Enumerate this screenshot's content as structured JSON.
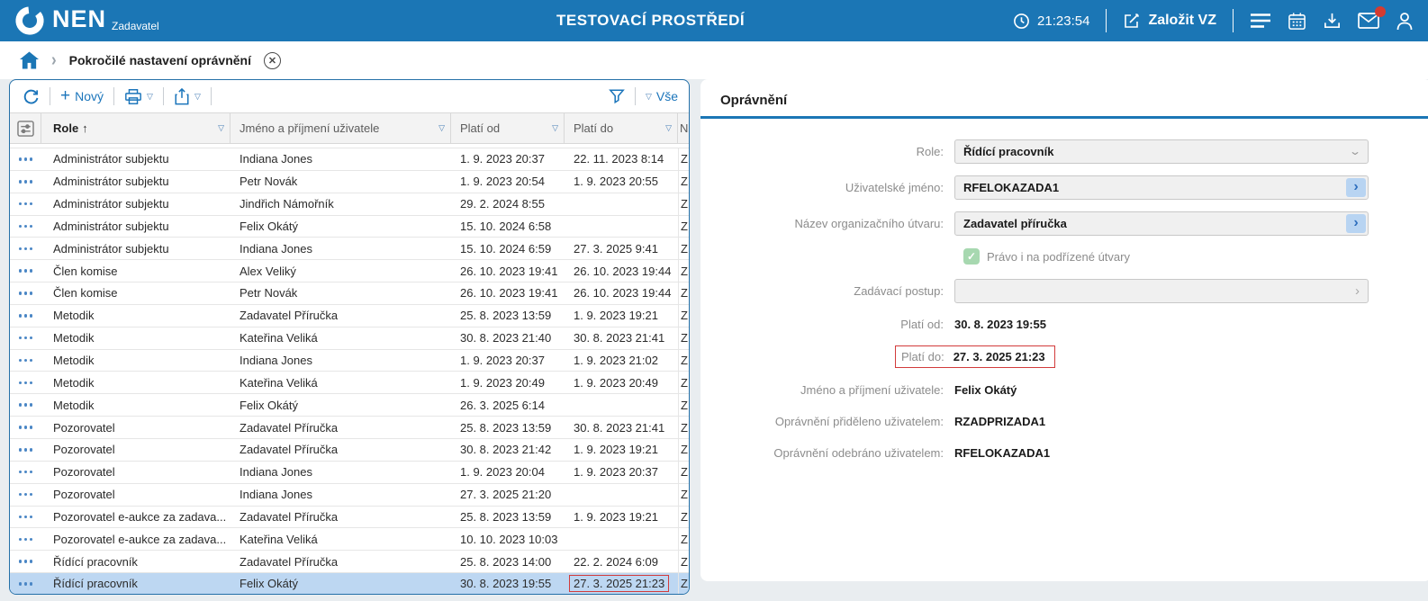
{
  "topbar": {
    "brand": "NEN",
    "brand_sub": "Zadavatel",
    "env_title": "TESTOVACÍ PROSTŘEDÍ",
    "time": "21:23:54",
    "new_tender_label": "Založit VZ"
  },
  "breadcrumb": {
    "page_title": "Pokročilé nastavení oprávnění"
  },
  "toolbar": {
    "new_label": "Nový",
    "all_label": "Vše"
  },
  "table": {
    "columns": [
      "Role",
      "Jméno a příjmení uživatele",
      "Platí od",
      "Platí do"
    ],
    "sorted_by": "Role ascending",
    "clipped_column": {
      "header_fragment": "N",
      "cell_fragment": "Z"
    },
    "selected_index": 19,
    "rows": [
      {
        "role": "Administrátor subjektu",
        "name": "Indiana Jones",
        "from": "1. 9. 2023 20:37",
        "to": "22. 11. 2023 8:14"
      },
      {
        "role": "Administrátor subjektu",
        "name": "Petr Novák",
        "from": "1. 9. 2023 20:54",
        "to": "1. 9. 2023 20:55"
      },
      {
        "role": "Administrátor subjektu",
        "name": "Jindřich Námořník",
        "from": "29. 2. 2024 8:55",
        "to": ""
      },
      {
        "role": "Administrátor subjektu",
        "name": "Felix Okátý",
        "from": "15. 10. 2024 6:58",
        "to": ""
      },
      {
        "role": "Administrátor subjektu",
        "name": "Indiana Jones",
        "from": "15. 10. 2024 6:59",
        "to": "27. 3. 2025 9:41"
      },
      {
        "role": "Člen komise",
        "name": "Alex Veliký",
        "from": "26. 10. 2023 19:41",
        "to": "26. 10. 2023 19:44"
      },
      {
        "role": "Člen komise",
        "name": "Petr Novák",
        "from": "26. 10. 2023 19:41",
        "to": "26. 10. 2023 19:44"
      },
      {
        "role": "Metodik",
        "name": "Zadavatel Příručka",
        "from": "25. 8. 2023 13:59",
        "to": "1. 9. 2023 19:21"
      },
      {
        "role": "Metodik",
        "name": "Kateřina Veliká",
        "from": "30. 8. 2023 21:40",
        "to": "30. 8. 2023 21:41"
      },
      {
        "role": "Metodik",
        "name": "Indiana Jones",
        "from": "1. 9. 2023 20:37",
        "to": "1. 9. 2023 21:02"
      },
      {
        "role": "Metodik",
        "name": "Kateřina Veliká",
        "from": "1. 9. 2023 20:49",
        "to": "1. 9. 2023 20:49"
      },
      {
        "role": "Metodik",
        "name": "Felix Okátý",
        "from": "26. 3. 2025 6:14",
        "to": ""
      },
      {
        "role": "Pozorovatel",
        "name": "Zadavatel Příručka",
        "from": "25. 8. 2023 13:59",
        "to": "30. 8. 2023 21:41"
      },
      {
        "role": "Pozorovatel",
        "name": "Zadavatel Příručka",
        "from": "30. 8. 2023 21:42",
        "to": "1. 9. 2023 19:21"
      },
      {
        "role": "Pozorovatel",
        "name": "Indiana Jones",
        "from": "1. 9. 2023 20:04",
        "to": "1. 9. 2023 20:37"
      },
      {
        "role": "Pozorovatel",
        "name": "Indiana Jones",
        "from": "27. 3. 2025 21:20",
        "to": ""
      },
      {
        "role": "Pozorovatel e-aukce za zadava...",
        "name": "Zadavatel Příručka",
        "from": "25. 8. 2023 13:59",
        "to": "1. 9. 2023 19:21"
      },
      {
        "role": "Pozorovatel e-aukce za zadava...",
        "name": "Kateřina Veliká",
        "from": "10. 10. 2023 10:03",
        "to": ""
      },
      {
        "role": "Řídící pracovník",
        "name": "Zadavatel Příručka",
        "from": "25. 8. 2023 14:00",
        "to": "22. 2. 2024 6:09"
      },
      {
        "role": "Řídící pracovník",
        "name": "Felix Okátý",
        "from": "30. 8. 2023 19:55",
        "to": "27. 3. 2025 21:23",
        "boxed": true
      }
    ]
  },
  "detail": {
    "title": "Oprávnění",
    "role_label": "Role:",
    "role_value": "Řídící pracovník",
    "username_label": "Uživatelské jméno:",
    "username_value": "RFELOKAZADA1",
    "org_label": "Název organizačního útvaru:",
    "org_value": "Zadavatel příručka",
    "suborg_checkbox_label": "Právo i na podřízené útvary",
    "suborg_checked": true,
    "procedure_label": "Zadávací postup:",
    "procedure_value": "",
    "valid_from_label": "Platí od:",
    "valid_from_value": "30. 8. 2023 19:55",
    "valid_to_label": "Platí do:",
    "valid_to_value": "27. 3. 2025 21:23",
    "fullname_label": "Jméno a příjmení uživatele:",
    "fullname_value": "Felix Okátý",
    "granted_label": "Oprávnění přiděleno uživatelem:",
    "granted_value": "RZADPRIZADA1",
    "revoked_label": "Oprávnění odebráno uživatelem:",
    "revoked_value": "RFELOKAZADA1"
  },
  "colors": {
    "accent_blue": "#1b76b5",
    "selected_row": "#bdd7f2",
    "highlight_red": "#d23b3b",
    "checkbox_green": "#a7d8b0"
  }
}
